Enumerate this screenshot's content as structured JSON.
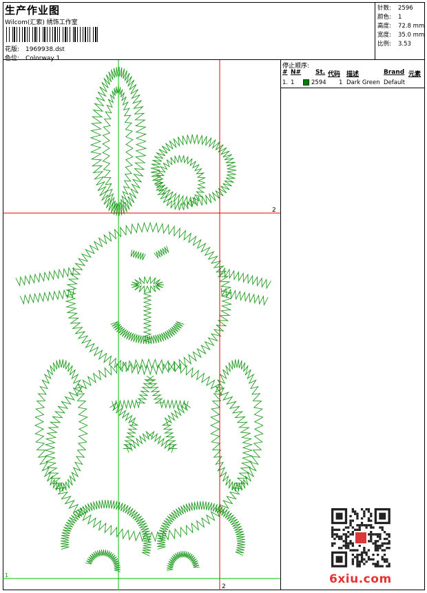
{
  "header": {
    "title": "生产作业图",
    "studio": "Wilcom(汇索) 绣饰工作室",
    "pattern_label": "花版:",
    "pattern_value": "1969938.dst",
    "color_label": "色位:",
    "color_value": "Colorway 1"
  },
  "stats": [
    {
      "label": "针数:",
      "value": "2596"
    },
    {
      "label": "颜色:",
      "value": "1"
    },
    {
      "label": "高度:",
      "value": "72.8 mm"
    },
    {
      "label": "宽度:",
      "value": "35.0 mm"
    },
    {
      "label": "比例:",
      "value": "3.53"
    }
  ],
  "stop_sequence": {
    "title": "停止顺序:",
    "headers": {
      "num": "#",
      "n": "N#",
      "st": "St.",
      "code": "代码",
      "desc": "描述",
      "brand": "Brand",
      "elem": "元素"
    },
    "rows": [
      {
        "num": "1.",
        "n": "1",
        "swatch_color": "#008000",
        "st": "2594",
        "code": "1",
        "desc": "Dark Green",
        "brand": "Default"
      }
    ]
  },
  "design": {
    "thread_color": "#1f9a1f",
    "guide_red": "#e00000",
    "guide_green": "#00c000",
    "markers": [
      "2",
      "2",
      "1"
    ]
  },
  "watermark": {
    "text": "6xiu.com",
    "color": "#e8322f"
  }
}
